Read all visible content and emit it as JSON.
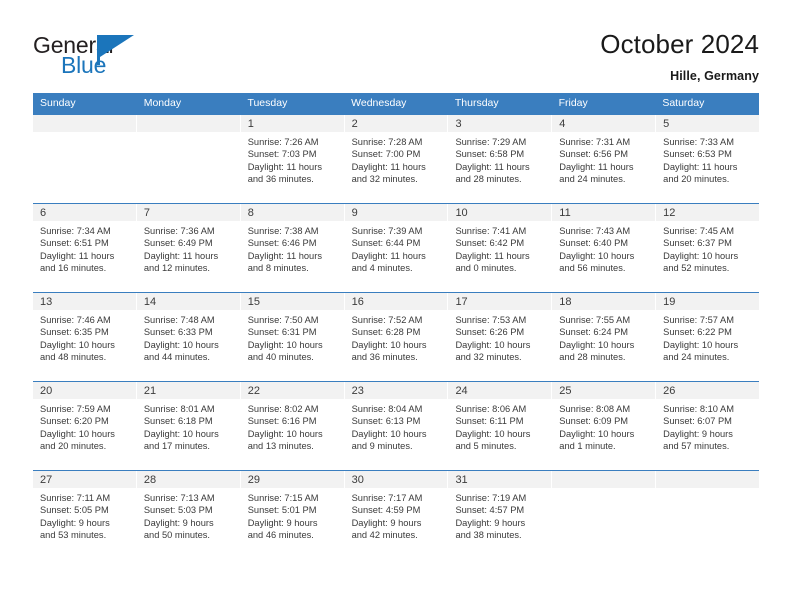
{
  "brand": {
    "name_top": "General",
    "name_bottom": "Blue",
    "accent_color": "#1b75bb",
    "flag_icon": "triangle-flag-icon"
  },
  "header": {
    "title": "October 2024",
    "subtitle": "Hille, Germany"
  },
  "theme": {
    "header_row_bg": "#3a7ebf",
    "header_row_text": "#ffffff",
    "day_number_bg": "#f2f2f2",
    "separator_color": "#3a7ebf",
    "text_color": "#3a3a3a"
  },
  "weekdays": [
    "Sunday",
    "Monday",
    "Tuesday",
    "Wednesday",
    "Thursday",
    "Friday",
    "Saturday"
  ],
  "labels": {
    "sunrise_prefix": "Sunrise:",
    "sunset_prefix": "Sunset:",
    "daylight_prefix": "Daylight:"
  },
  "weeks": [
    [
      {
        "day": "",
        "empty": true,
        "line1": "",
        "line2": "",
        "line3": "",
        "line4": ""
      },
      {
        "day": "",
        "empty": true,
        "line1": "",
        "line2": "",
        "line3": "",
        "line4": ""
      },
      {
        "day": "1",
        "empty": false,
        "line1": "Sunrise: 7:26 AM",
        "line2": "Sunset: 7:03 PM",
        "line3": "Daylight: 11 hours",
        "line4": "and 36 minutes."
      },
      {
        "day": "2",
        "empty": false,
        "line1": "Sunrise: 7:28 AM",
        "line2": "Sunset: 7:00 PM",
        "line3": "Daylight: 11 hours",
        "line4": "and 32 minutes."
      },
      {
        "day": "3",
        "empty": false,
        "line1": "Sunrise: 7:29 AM",
        "line2": "Sunset: 6:58 PM",
        "line3": "Daylight: 11 hours",
        "line4": "and 28 minutes."
      },
      {
        "day": "4",
        "empty": false,
        "line1": "Sunrise: 7:31 AM",
        "line2": "Sunset: 6:56 PM",
        "line3": "Daylight: 11 hours",
        "line4": "and 24 minutes."
      },
      {
        "day": "5",
        "empty": false,
        "line1": "Sunrise: 7:33 AM",
        "line2": "Sunset: 6:53 PM",
        "line3": "Daylight: 11 hours",
        "line4": "and 20 minutes."
      }
    ],
    [
      {
        "day": "6",
        "empty": false,
        "line1": "Sunrise: 7:34 AM",
        "line2": "Sunset: 6:51 PM",
        "line3": "Daylight: 11 hours",
        "line4": "and 16 minutes."
      },
      {
        "day": "7",
        "empty": false,
        "line1": "Sunrise: 7:36 AM",
        "line2": "Sunset: 6:49 PM",
        "line3": "Daylight: 11 hours",
        "line4": "and 12 minutes."
      },
      {
        "day": "8",
        "empty": false,
        "line1": "Sunrise: 7:38 AM",
        "line2": "Sunset: 6:46 PM",
        "line3": "Daylight: 11 hours",
        "line4": "and 8 minutes."
      },
      {
        "day": "9",
        "empty": false,
        "line1": "Sunrise: 7:39 AM",
        "line2": "Sunset: 6:44 PM",
        "line3": "Daylight: 11 hours",
        "line4": "and 4 minutes."
      },
      {
        "day": "10",
        "empty": false,
        "line1": "Sunrise: 7:41 AM",
        "line2": "Sunset: 6:42 PM",
        "line3": "Daylight: 11 hours",
        "line4": "and 0 minutes."
      },
      {
        "day": "11",
        "empty": false,
        "line1": "Sunrise: 7:43 AM",
        "line2": "Sunset: 6:40 PM",
        "line3": "Daylight: 10 hours",
        "line4": "and 56 minutes."
      },
      {
        "day": "12",
        "empty": false,
        "line1": "Sunrise: 7:45 AM",
        "line2": "Sunset: 6:37 PM",
        "line3": "Daylight: 10 hours",
        "line4": "and 52 minutes."
      }
    ],
    [
      {
        "day": "13",
        "empty": false,
        "line1": "Sunrise: 7:46 AM",
        "line2": "Sunset: 6:35 PM",
        "line3": "Daylight: 10 hours",
        "line4": "and 48 minutes."
      },
      {
        "day": "14",
        "empty": false,
        "line1": "Sunrise: 7:48 AM",
        "line2": "Sunset: 6:33 PM",
        "line3": "Daylight: 10 hours",
        "line4": "and 44 minutes."
      },
      {
        "day": "15",
        "empty": false,
        "line1": "Sunrise: 7:50 AM",
        "line2": "Sunset: 6:31 PM",
        "line3": "Daylight: 10 hours",
        "line4": "and 40 minutes."
      },
      {
        "day": "16",
        "empty": false,
        "line1": "Sunrise: 7:52 AM",
        "line2": "Sunset: 6:28 PM",
        "line3": "Daylight: 10 hours",
        "line4": "and 36 minutes."
      },
      {
        "day": "17",
        "empty": false,
        "line1": "Sunrise: 7:53 AM",
        "line2": "Sunset: 6:26 PM",
        "line3": "Daylight: 10 hours",
        "line4": "and 32 minutes."
      },
      {
        "day": "18",
        "empty": false,
        "line1": "Sunrise: 7:55 AM",
        "line2": "Sunset: 6:24 PM",
        "line3": "Daylight: 10 hours",
        "line4": "and 28 minutes."
      },
      {
        "day": "19",
        "empty": false,
        "line1": "Sunrise: 7:57 AM",
        "line2": "Sunset: 6:22 PM",
        "line3": "Daylight: 10 hours",
        "line4": "and 24 minutes."
      }
    ],
    [
      {
        "day": "20",
        "empty": false,
        "line1": "Sunrise: 7:59 AM",
        "line2": "Sunset: 6:20 PM",
        "line3": "Daylight: 10 hours",
        "line4": "and 20 minutes."
      },
      {
        "day": "21",
        "empty": false,
        "line1": "Sunrise: 8:01 AM",
        "line2": "Sunset: 6:18 PM",
        "line3": "Daylight: 10 hours",
        "line4": "and 17 minutes."
      },
      {
        "day": "22",
        "empty": false,
        "line1": "Sunrise: 8:02 AM",
        "line2": "Sunset: 6:16 PM",
        "line3": "Daylight: 10 hours",
        "line4": "and 13 minutes."
      },
      {
        "day": "23",
        "empty": false,
        "line1": "Sunrise: 8:04 AM",
        "line2": "Sunset: 6:13 PM",
        "line3": "Daylight: 10 hours",
        "line4": "and 9 minutes."
      },
      {
        "day": "24",
        "empty": false,
        "line1": "Sunrise: 8:06 AM",
        "line2": "Sunset: 6:11 PM",
        "line3": "Daylight: 10 hours",
        "line4": "and 5 minutes."
      },
      {
        "day": "25",
        "empty": false,
        "line1": "Sunrise: 8:08 AM",
        "line2": "Sunset: 6:09 PM",
        "line3": "Daylight: 10 hours",
        "line4": "and 1 minute."
      },
      {
        "day": "26",
        "empty": false,
        "line1": "Sunrise: 8:10 AM",
        "line2": "Sunset: 6:07 PM",
        "line3": "Daylight: 9 hours",
        "line4": "and 57 minutes."
      }
    ],
    [
      {
        "day": "27",
        "empty": false,
        "line1": "Sunrise: 7:11 AM",
        "line2": "Sunset: 5:05 PM",
        "line3": "Daylight: 9 hours",
        "line4": "and 53 minutes."
      },
      {
        "day": "28",
        "empty": false,
        "line1": "Sunrise: 7:13 AM",
        "line2": "Sunset: 5:03 PM",
        "line3": "Daylight: 9 hours",
        "line4": "and 50 minutes."
      },
      {
        "day": "29",
        "empty": false,
        "line1": "Sunrise: 7:15 AM",
        "line2": "Sunset: 5:01 PM",
        "line3": "Daylight: 9 hours",
        "line4": "and 46 minutes."
      },
      {
        "day": "30",
        "empty": false,
        "line1": "Sunrise: 7:17 AM",
        "line2": "Sunset: 4:59 PM",
        "line3": "Daylight: 9 hours",
        "line4": "and 42 minutes."
      },
      {
        "day": "31",
        "empty": false,
        "line1": "Sunrise: 7:19 AM",
        "line2": "Sunset: 4:57 PM",
        "line3": "Daylight: 9 hours",
        "line4": "and 38 minutes."
      },
      {
        "day": "",
        "empty": true,
        "line1": "",
        "line2": "",
        "line3": "",
        "line4": ""
      },
      {
        "day": "",
        "empty": true,
        "line1": "",
        "line2": "",
        "line3": "",
        "line4": ""
      }
    ]
  ]
}
